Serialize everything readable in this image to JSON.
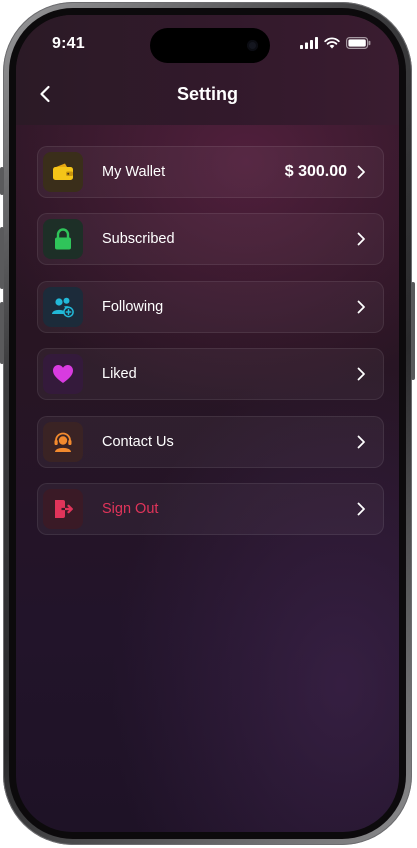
{
  "status_bar": {
    "time": "9:41"
  },
  "header": {
    "title": "Setting",
    "back_icon": "chevron-left-icon"
  },
  "menu": {
    "items": [
      {
        "label": "My Wallet",
        "value": "$ 300.00",
        "icon": "wallet-icon",
        "icon_color": "#f5c518",
        "icon_bg": "#3a2e1a",
        "variant": "default"
      },
      {
        "label": "Subscribed",
        "icon": "lock-icon",
        "icon_color": "#2fc45a",
        "icon_bg": "#1d2f27",
        "variant": "default"
      },
      {
        "label": "Following",
        "icon": "users-add-icon",
        "icon_color": "#22b9d8",
        "icon_bg": "#1c2b3a",
        "variant": "default"
      },
      {
        "label": "Liked",
        "icon": "heart-icon",
        "icon_color": "#d83be0",
        "icon_bg": "#341a3b",
        "variant": "default"
      },
      {
        "label": "Contact Us",
        "icon": "headset-icon",
        "icon_color": "#f28a2e",
        "icon_bg": "#3a2324",
        "variant": "default"
      },
      {
        "label": "Sign Out",
        "icon": "sign-out-icon",
        "icon_color": "#e0345a",
        "icon_bg": "#3a1a26",
        "variant": "danger"
      }
    ]
  },
  "colors": {
    "accent_danger": "#e0345a",
    "background": "#281523"
  }
}
